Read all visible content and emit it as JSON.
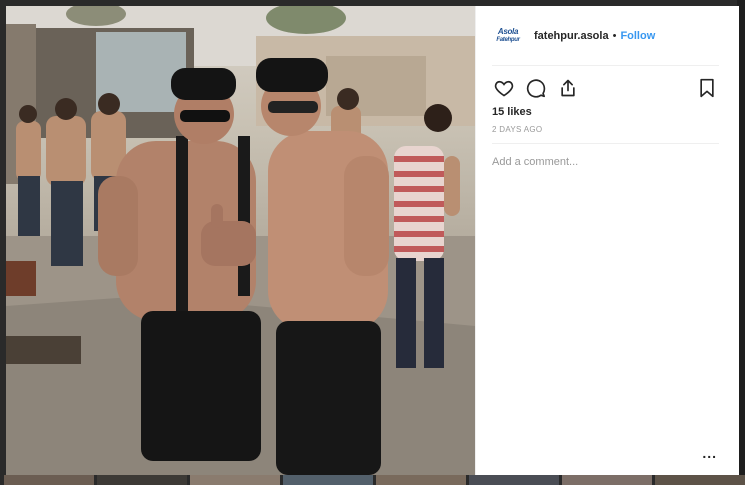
{
  "post": {
    "username": "fatehpur.asola",
    "separator": "•",
    "follow_label": "Follow",
    "avatar_text_line1": "Asola",
    "avatar_text_line2": "Fatehpur",
    "likes": "15 likes",
    "time": "2 DAYS AGO",
    "comment_placeholder": "Add a comment...",
    "more_label": "..."
  },
  "icons": {
    "like": "heart-icon",
    "comment": "comment-icon",
    "share": "share-icon",
    "save": "bookmark-icon",
    "more": "more-options-icon"
  },
  "colors": {
    "link": "#3897f0",
    "text": "#262626",
    "muted": "#999999",
    "brand": "#1d4f91"
  }
}
